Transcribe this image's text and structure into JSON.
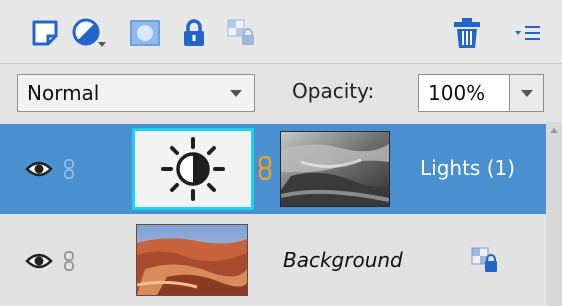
{
  "toolbar": {
    "icons": [
      "new-layer-icon",
      "adjustment-layer-icon",
      "add-mask-icon",
      "lock-all-icon",
      "lock-transparency-icon",
      "delete-layer-icon",
      "panel-menu-icon"
    ]
  },
  "blend": {
    "mode": "Normal",
    "opacity_label": "Opacity:",
    "opacity_value": "100%"
  },
  "layers": [
    {
      "name": "Lights (1)",
      "selected": true,
      "visible": true
    },
    {
      "name": "Background",
      "selected": false,
      "visible": true,
      "locked": true
    }
  ],
  "colors": {
    "selected_row": "#4a8fd0",
    "toolbar_blue": "#2266cc",
    "lock_orange": "#e8a12c",
    "adjust_border": "#1fd2f2"
  }
}
